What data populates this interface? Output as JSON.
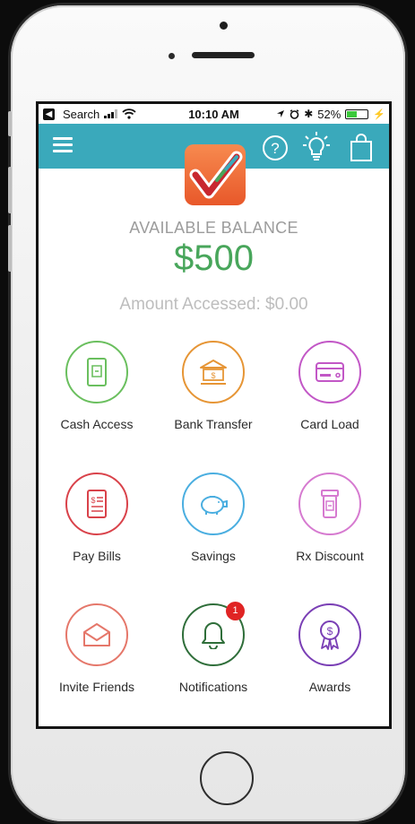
{
  "status_bar": {
    "back_label": "Search",
    "time": "10:10 AM",
    "battery": "52%",
    "battery_level": 0.52
  },
  "app_bar": {
    "icons": [
      "menu-icon",
      "help-icon",
      "lightbulb-icon",
      "shopping-bag-icon"
    ],
    "accent": "#3aa9bb"
  },
  "balance": {
    "label": "AVAILABLE BALANCE",
    "value": "$500",
    "accessed": "Amount Accessed: $0.00",
    "value_color": "#48a65b"
  },
  "tiles": [
    {
      "label": "Cash Access",
      "icon": "atm-icon",
      "color": "#6abf5e"
    },
    {
      "label": "Bank Transfer",
      "icon": "bank-icon",
      "color": "#e69535"
    },
    {
      "label": "Card Load",
      "icon": "credit-card-icon",
      "color": "#c257c6"
    },
    {
      "label": "Pay Bills",
      "icon": "bill-icon",
      "color": "#d9424a"
    },
    {
      "label": "Savings",
      "icon": "piggy-bank-icon",
      "color": "#4aaee0"
    },
    {
      "label": "Rx Discount",
      "icon": "pill-bottle-icon",
      "color": "#d67ad0"
    },
    {
      "label": "Invite Friends",
      "icon": "envelope-icon",
      "color": "#e5776a"
    },
    {
      "label": "Notifications",
      "icon": "bell-icon",
      "color": "#2f6e3a",
      "badge": "1"
    },
    {
      "label": "Awards",
      "icon": "award-ribbon-icon",
      "color": "#7a3fb5"
    }
  ]
}
